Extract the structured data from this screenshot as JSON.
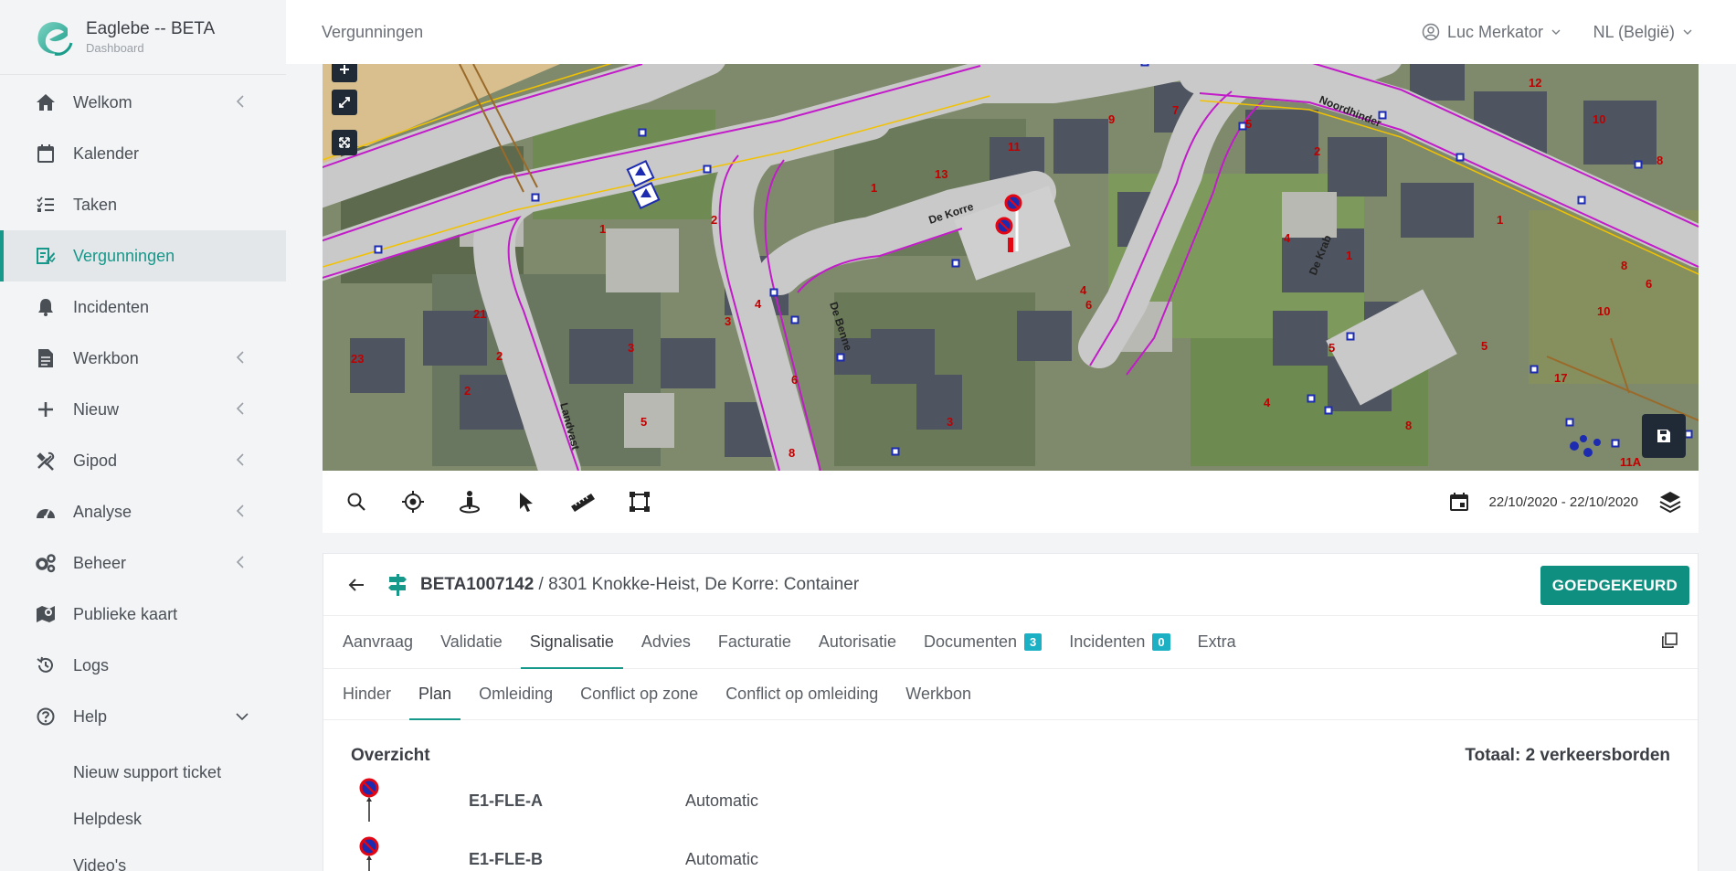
{
  "brand": {
    "name": "Eaglebe -- BETA",
    "subtitle": "Dashboard"
  },
  "nav": {
    "items": [
      {
        "label": "Welkom",
        "icon": "home-icon",
        "has_children": true
      },
      {
        "label": "Kalender",
        "icon": "calendar-icon",
        "has_children": false
      },
      {
        "label": "Taken",
        "icon": "task-list-icon",
        "has_children": false
      },
      {
        "label": "Vergunningen",
        "icon": "permit-icon",
        "has_children": false,
        "active": true
      },
      {
        "label": "Incidenten",
        "icon": "bell-icon",
        "has_children": false
      },
      {
        "label": "Werkbon",
        "icon": "document-icon",
        "has_children": true
      },
      {
        "label": "Nieuw",
        "icon": "plus-icon",
        "has_children": true
      },
      {
        "label": "Gipod",
        "icon": "tools-icon",
        "has_children": true
      },
      {
        "label": "Analyse",
        "icon": "gauge-icon",
        "has_children": true
      },
      {
        "label": "Beheer",
        "icon": "gears-icon",
        "has_children": true
      },
      {
        "label": "Publieke kaart",
        "icon": "map-icon",
        "has_children": false
      },
      {
        "label": "Logs",
        "icon": "history-icon",
        "has_children": false
      },
      {
        "label": "Help",
        "icon": "help-icon",
        "has_children": true,
        "expanded": true
      }
    ],
    "help_children": [
      "Nieuw support ticket",
      "Helpdesk",
      "Video's"
    ]
  },
  "topbar": {
    "breadcrumb": "Vergunningen",
    "user": "Luc Merkator",
    "language": "NL (België)"
  },
  "map": {
    "street_labels": [
      "Noordhinder",
      "De Korre",
      "De Benne",
      "Landvast",
      "De Krab"
    ],
    "house_numbers": [
      "12",
      "10",
      "8",
      "9",
      "7",
      "5",
      "2",
      "11",
      "13",
      "1",
      "2",
      "1",
      "4",
      "4",
      "4",
      "6",
      "1",
      "21",
      "3",
      "3",
      "2",
      "23",
      "2",
      "6",
      "5",
      "8",
      "5",
      "3",
      "8",
      "4",
      "10",
      "6",
      "8",
      "5",
      "17",
      "11A",
      "1"
    ],
    "colors": {
      "road": "#c8c8c8",
      "utility_line": "#c21bc9",
      "curb": "#f2c200",
      "marker": "#1c2bb0"
    }
  },
  "toolbar": {
    "tools": [
      "search-icon",
      "locate-icon",
      "streetview-icon",
      "pointer-icon",
      "ruler-icon",
      "polygon-icon"
    ],
    "date_range": "22/10/2020 - 22/10/2020"
  },
  "permit": {
    "id": "BETA1007142",
    "separator": " / ",
    "description": "8301 Knokke-Heist, De Korre: Container",
    "status_button": "GOEDGEKEURD",
    "status_color": "#0f8f80"
  },
  "tabs": [
    {
      "label": "Aanvraag"
    },
    {
      "label": "Validatie"
    },
    {
      "label": "Signalisatie",
      "active": true
    },
    {
      "label": "Advies"
    },
    {
      "label": "Facturatie"
    },
    {
      "label": "Autorisatie"
    },
    {
      "label": "Documenten",
      "badge": "3"
    },
    {
      "label": "Incidenten",
      "badge": "0"
    },
    {
      "label": "Extra"
    }
  ],
  "subtabs": [
    {
      "label": "Hinder"
    },
    {
      "label": "Plan",
      "active": true
    },
    {
      "label": "Omleiding"
    },
    {
      "label": "Conflict op zone"
    },
    {
      "label": "Conflict op omleiding"
    },
    {
      "label": "Werkbon"
    }
  ],
  "overview": {
    "title": "Overzicht",
    "total": "Totaal: 2 verkeersborden",
    "signs": [
      {
        "code": "E1-FLE-A",
        "mode": "Automatic",
        "icon": "no-parking-sign-icon"
      },
      {
        "code": "E1-FLE-B",
        "mode": "Automatic",
        "icon": "no-parking-sign-icon"
      }
    ]
  }
}
